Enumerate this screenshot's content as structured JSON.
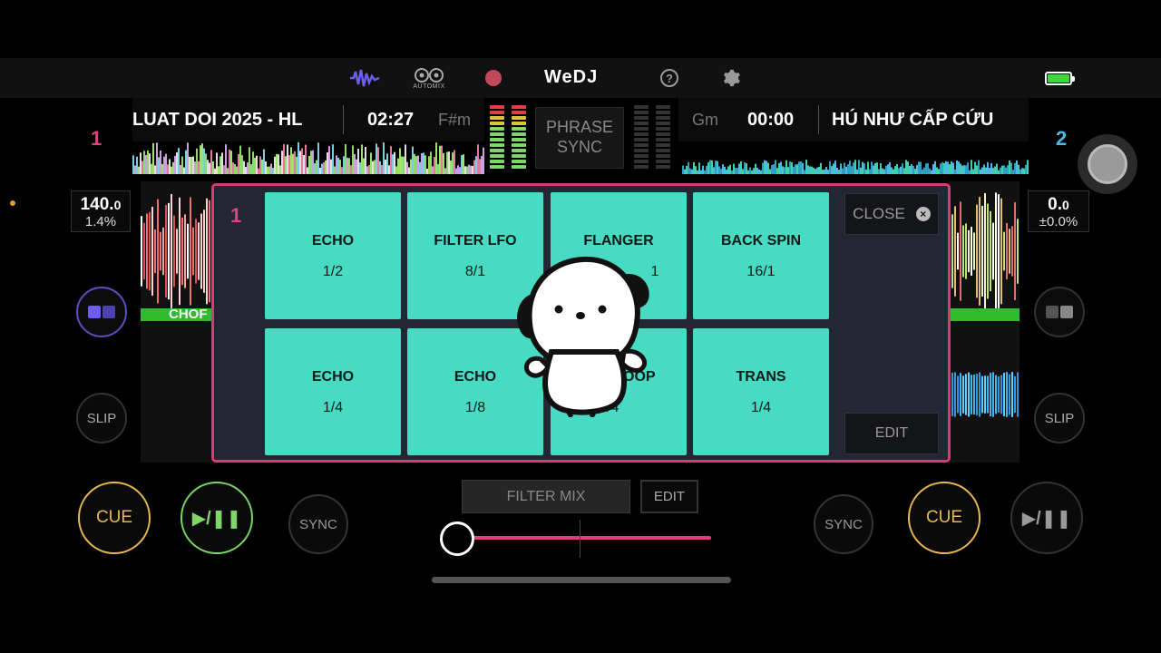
{
  "app": {
    "title": "WeDJ"
  },
  "topbar": {
    "wave_icon": "waveform-icon",
    "automix_label": "AUTOMIX",
    "record_icon": "record-icon",
    "help_icon": "help-icon",
    "help_glyph": "?",
    "settings_icon": "gear-icon",
    "battery_icon": "battery-icon"
  },
  "deck1": {
    "number": "1",
    "track_title": "LUAT DOI 2025 - HL",
    "time": "02:27",
    "key": "F#m",
    "bpm_int": "140.",
    "bpm_dec": "0",
    "pitch": "1.4%",
    "phrase_label": "CHOF",
    "cue_label": "CUE",
    "play_label": "▶/❚❚",
    "sync_label": "SYNC",
    "slip_label": "SLIP",
    "color": "#e0407c"
  },
  "deck2": {
    "number": "2",
    "track_title": "HÚ NHƯ CẤP CỨU",
    "time": "00:00",
    "key": "Gm",
    "bpm_int": "0.",
    "bpm_dec": "0",
    "pitch": "±0.0%",
    "cue_label": "CUE",
    "play_label": "▶/❚❚",
    "sync_label": "SYNC",
    "slip_label": "SLIP",
    "color": "#4fb8e6"
  },
  "center": {
    "phrase_sync_line1": "PHRASE",
    "phrase_sync_line2": "SYNC",
    "filter_mix_label": "FILTER MIX",
    "filter_edit_label": "EDIT"
  },
  "fx_panel": {
    "deck_number": "1",
    "close_label": "CLOSE",
    "close_icon": "close-circle-icon",
    "edit_label": "EDIT",
    "pads": [
      {
        "name": "ECHO",
        "value": "1/2"
      },
      {
        "name": "FILTER LFO",
        "value": "8/1"
      },
      {
        "name": "FLANGER",
        "value": "1"
      },
      {
        "name": "BACK SPIN",
        "value": "16/1"
      },
      {
        "name": "ECHO",
        "value": "1/4"
      },
      {
        "name": "ECHO",
        "value": "1/8"
      },
      {
        "name": "OOP",
        "value": "/4"
      },
      {
        "name": "TRANS",
        "value": "1/4"
      }
    ]
  },
  "colors": {
    "accent_pink": "#e0407c",
    "accent_blue": "#4fb8e6",
    "pad_teal": "#46dbc2",
    "cue_yellow": "#e9b850",
    "play_green": "#7ed66a"
  },
  "crossfader": {
    "position_fraction": 0.0
  }
}
